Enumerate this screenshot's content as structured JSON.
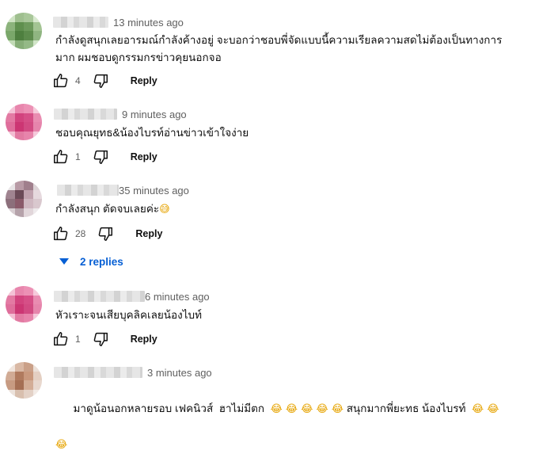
{
  "colors": {
    "accent": "#065fd4",
    "meta": "#606060",
    "text": "#0f0f0f"
  },
  "comments": [
    {
      "time": "13 minutes ago",
      "lines": [
        "กำลังดูสนุกเลยอารมณ์กำลังค้างอยู่ จะบอกว่าชอบพี่จัดแบบนี้ความเรียลความสดไม่ต้องเป็นทางการ",
        "มาก ผมชอบดูกรรมกรข่าวคุยนอกจอ"
      ],
      "likes": "4",
      "reply_label": "Reply"
    },
    {
      "time": "9 minutes ago",
      "lines": [
        "ชอบคุณยุทธ&น้องไบรท์อ่านข่าวเข้าใจง่าย"
      ],
      "likes": "1",
      "reply_label": "Reply"
    },
    {
      "time": "35 minutes ago",
      "lines": [
        "กำลังสนุก ตัดจบเลยค่ะ"
      ],
      "emoji": "😅",
      "likes": "28",
      "reply_label": "Reply",
      "replies_label": "2 replies"
    },
    {
      "time": "6 minutes ago",
      "lines": [
        "หัวเราะจนเสียบุคลิคเลยน้องไบท์"
      ],
      "likes": "1",
      "reply_label": "Reply"
    },
    {
      "time": "3 minutes ago",
      "line_a": "มาดูน้อนอกหลายรอบ เฟคนิวส์  ฮาไม่มีตก  ",
      "emoji_run_a": "😂 😂 😂 😂 😂",
      "line_b": "สนุกมากพี่ยะทธ น้องไบรท์  ",
      "emoji_run_b": "😂 😂",
      "emoji_line2": "😂"
    }
  ],
  "icons": {
    "like": "thumb-up-icon",
    "dislike": "thumb-down-icon",
    "expand": "chevron-down-icon"
  }
}
